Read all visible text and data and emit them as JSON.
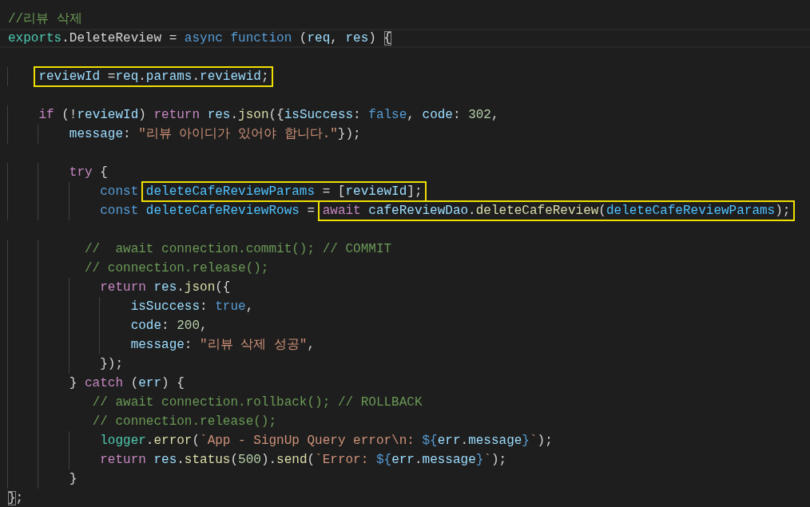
{
  "editor": {
    "lines": [
      {
        "current": false,
        "segments": [
          {
            "kind": "code",
            "tokens": [
              {
                "text": "//리뷰 삭제",
                "kind": "comment"
              }
            ]
          }
        ]
      },
      {
        "current": true,
        "segments": [
          {
            "kind": "code",
            "tokens": [
              {
                "text": "exports",
                "kind": "module"
              },
              {
                "text": ".DeleteReview = ",
                "kind": "plain"
              },
              {
                "text": "async ",
                "kind": "keyword"
              },
              {
                "text": "function",
                "kind": "keyword"
              },
              {
                "text": " (",
                "kind": "plain"
              },
              {
                "text": "req",
                "kind": "var"
              },
              {
                "text": ", ",
                "kind": "plain"
              },
              {
                "text": "res",
                "kind": "var"
              },
              {
                "text": ") ",
                "kind": "plain"
              },
              {
                "text": "{",
                "kind": "bracket-match"
              }
            ]
          }
        ]
      },
      {
        "current": false
      },
      {
        "current": false,
        "segments": [
          {
            "kind": "highlight",
            "tokens": [
              {
                "text": "    reviewId",
                "kind": "var"
              },
              {
                "text": " =",
                "kind": "plain"
              },
              {
                "text": "req",
                "kind": "var"
              },
              {
                "text": ".",
                "kind": "plain"
              },
              {
                "text": "params",
                "kind": "var"
              },
              {
                "text": ".",
                "kind": "plain"
              },
              {
                "text": "reviewid",
                "kind": "var"
              },
              {
                "text": ";",
                "kind": "plain"
              }
            ]
          }
        ]
      },
      {
        "current": false
      },
      {
        "current": false,
        "segments": [
          {
            "kind": "code",
            "tokens": [
              {
                "text": "    if",
                "kind": "control"
              },
              {
                "text": " (!",
                "kind": "plain"
              },
              {
                "text": "reviewId",
                "kind": "var"
              },
              {
                "text": ") ",
                "kind": "plain"
              },
              {
                "text": "return ",
                "kind": "control"
              },
              {
                "text": "res",
                "kind": "var"
              },
              {
                "text": ".",
                "kind": "plain"
              },
              {
                "text": "json",
                "kind": "fn"
              },
              {
                "text": "({",
                "kind": "plain"
              },
              {
                "text": "isSuccess",
                "kind": "var"
              },
              {
                "text": ": ",
                "kind": "plain"
              },
              {
                "text": "false",
                "kind": "keyword"
              },
              {
                "text": ", ",
                "kind": "plain"
              },
              {
                "text": "code",
                "kind": "var"
              },
              {
                "text": ": ",
                "kind": "plain"
              },
              {
                "text": "302",
                "kind": "number"
              },
              {
                "text": ",",
                "kind": "plain"
              }
            ]
          }
        ]
      },
      {
        "current": false,
        "segments": [
          {
            "kind": "code",
            "tokens": [
              {
                "text": "        message",
                "kind": "var"
              },
              {
                "text": ": ",
                "kind": "plain"
              },
              {
                "text": "\"리뷰 아이디가 있어야 합니다.\"",
                "kind": "string"
              },
              {
                "text": "});",
                "kind": "plain"
              }
            ]
          }
        ]
      },
      {
        "current": false
      },
      {
        "current": false,
        "segments": [
          {
            "kind": "code",
            "tokens": [
              {
                "text": "        try",
                "kind": "control"
              },
              {
                "text": " {",
                "kind": "plain"
              }
            ]
          }
        ]
      },
      {
        "current": false,
        "segments": [
          {
            "kind": "code",
            "tokens": [
              {
                "text": "            const ",
                "kind": "keyword"
              }
            ]
          },
          {
            "kind": "highlight",
            "tokens": [
              {
                "text": "deleteCafeReviewParams",
                "kind": "const"
              },
              {
                "text": " = [",
                "kind": "plain"
              },
              {
                "text": "reviewId",
                "kind": "var"
              },
              {
                "text": "];",
                "kind": "plain"
              }
            ]
          }
        ]
      },
      {
        "current": false,
        "segments": [
          {
            "kind": "code",
            "tokens": [
              {
                "text": "            const ",
                "kind": "keyword"
              },
              {
                "text": "deleteCafeReviewRows",
                "kind": "const"
              },
              {
                "text": " = ",
                "kind": "plain"
              }
            ]
          },
          {
            "kind": "highlight",
            "tokens": [
              {
                "text": "await ",
                "kind": "control"
              },
              {
                "text": "cafeReviewDao",
                "kind": "var"
              },
              {
                "text": ".",
                "kind": "plain"
              },
              {
                "text": "deleteCafeReview",
                "kind": "fn"
              },
              {
                "text": "(",
                "kind": "plain"
              },
              {
                "text": "deleteCafeReviewParams",
                "kind": "const"
              },
              {
                "text": ");",
                "kind": "plain"
              }
            ]
          }
        ]
      },
      {
        "current": false
      },
      {
        "current": false,
        "segments": [
          {
            "kind": "code",
            "tokens": [
              {
                "text": "          //  await connection.commit(); // COMMIT",
                "kind": "comment"
              }
            ]
          }
        ]
      },
      {
        "current": false,
        "segments": [
          {
            "kind": "code",
            "tokens": [
              {
                "text": "          // connection.release();",
                "kind": "comment"
              }
            ]
          }
        ]
      },
      {
        "current": false,
        "segments": [
          {
            "kind": "code",
            "tokens": [
              {
                "text": "            return ",
                "kind": "control"
              },
              {
                "text": "res",
                "kind": "var"
              },
              {
                "text": ".",
                "kind": "plain"
              },
              {
                "text": "json",
                "kind": "fn"
              },
              {
                "text": "({",
                "kind": "plain"
              }
            ]
          }
        ]
      },
      {
        "current": false,
        "segments": [
          {
            "kind": "code",
            "tokens": [
              {
                "text": "                isSuccess",
                "kind": "var"
              },
              {
                "text": ": ",
                "kind": "plain"
              },
              {
                "text": "true",
                "kind": "keyword"
              },
              {
                "text": ",",
                "kind": "plain"
              }
            ]
          }
        ]
      },
      {
        "current": false,
        "segments": [
          {
            "kind": "code",
            "tokens": [
              {
                "text": "                code",
                "kind": "var"
              },
              {
                "text": ": ",
                "kind": "plain"
              },
              {
                "text": "200",
                "kind": "number"
              },
              {
                "text": ",",
                "kind": "plain"
              }
            ]
          }
        ]
      },
      {
        "current": false,
        "segments": [
          {
            "kind": "code",
            "tokens": [
              {
                "text": "                message",
                "kind": "var"
              },
              {
                "text": ": ",
                "kind": "plain"
              },
              {
                "text": "\"리뷰 삭제 성공\"",
                "kind": "string"
              },
              {
                "text": ",",
                "kind": "plain"
              }
            ]
          }
        ]
      },
      {
        "current": false,
        "segments": [
          {
            "kind": "code",
            "tokens": [
              {
                "text": "            });",
                "kind": "plain"
              }
            ]
          }
        ]
      },
      {
        "current": false,
        "segments": [
          {
            "kind": "code",
            "tokens": [
              {
                "text": "        } ",
                "kind": "plain"
              },
              {
                "text": "catch",
                "kind": "control"
              },
              {
                "text": " (",
                "kind": "plain"
              },
              {
                "text": "err",
                "kind": "var"
              },
              {
                "text": ") {",
                "kind": "plain"
              }
            ]
          }
        ]
      },
      {
        "current": false,
        "segments": [
          {
            "kind": "code",
            "tokens": [
              {
                "text": "           // await connection.rollback(); // ROLLBACK",
                "kind": "comment"
              }
            ]
          }
        ]
      },
      {
        "current": false,
        "segments": [
          {
            "kind": "code",
            "tokens": [
              {
                "text": "           // connection.release();",
                "kind": "comment"
              }
            ]
          }
        ]
      },
      {
        "current": false,
        "segments": [
          {
            "kind": "code",
            "tokens": [
              {
                "text": "            logger",
                "kind": "module"
              },
              {
                "text": ".",
                "kind": "plain"
              },
              {
                "text": "error",
                "kind": "fn"
              },
              {
                "text": "(",
                "kind": "plain"
              },
              {
                "text": "`App - SignUp Query error\\n: ",
                "kind": "string"
              },
              {
                "text": "${",
                "kind": "keyword"
              },
              {
                "text": "err",
                "kind": "var"
              },
              {
                "text": ".",
                "kind": "plain"
              },
              {
                "text": "message",
                "kind": "var"
              },
              {
                "text": "}",
                "kind": "keyword"
              },
              {
                "text": "`",
                "kind": "string"
              },
              {
                "text": ");",
                "kind": "plain"
              }
            ]
          }
        ]
      },
      {
        "current": false,
        "segments": [
          {
            "kind": "code",
            "tokens": [
              {
                "text": "            return ",
                "kind": "control"
              },
              {
                "text": "res",
                "kind": "var"
              },
              {
                "text": ".",
                "kind": "plain"
              },
              {
                "text": "status",
                "kind": "fn"
              },
              {
                "text": "(",
                "kind": "plain"
              },
              {
                "text": "500",
                "kind": "number"
              },
              {
                "text": ").",
                "kind": "plain"
              },
              {
                "text": "send",
                "kind": "fn"
              },
              {
                "text": "(",
                "kind": "plain"
              },
              {
                "text": "`Error: ",
                "kind": "string"
              },
              {
                "text": "${",
                "kind": "keyword"
              },
              {
                "text": "err",
                "kind": "var"
              },
              {
                "text": ".",
                "kind": "plain"
              },
              {
                "text": "message",
                "kind": "var"
              },
              {
                "text": "}",
                "kind": "keyword"
              },
              {
                "text": "`",
                "kind": "string"
              },
              {
                "text": ");",
                "kind": "plain"
              }
            ]
          }
        ]
      },
      {
        "current": false,
        "segments": [
          {
            "kind": "code",
            "tokens": [
              {
                "text": "        }",
                "kind": "plain"
              }
            ]
          }
        ]
      },
      {
        "current": false,
        "segments": [
          {
            "kind": "code",
            "tokens": [
              {
                "text": "}",
                "kind": "bracket-match"
              },
              {
                "text": ";",
                "kind": "plain"
              }
            ]
          }
        ]
      }
    ]
  }
}
